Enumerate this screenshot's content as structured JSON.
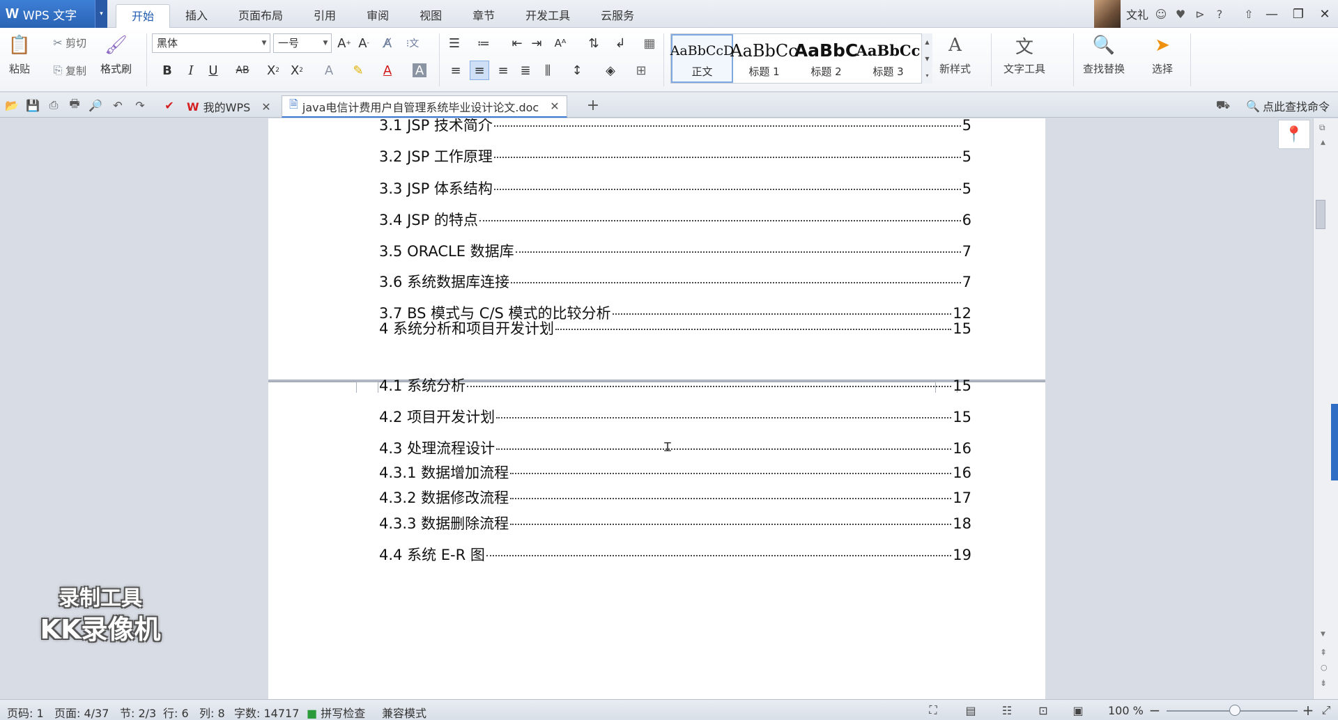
{
  "app": {
    "name": "WPS 文字",
    "logo_glyph": "W",
    "menu_arrow": "▾"
  },
  "menu_tabs": [
    "开始",
    "插入",
    "页面布局",
    "引用",
    "审阅",
    "视图",
    "章节",
    "开发工具",
    "云服务"
  ],
  "titlebar": {
    "username": "文礼",
    "help": "?",
    "minimize": "—",
    "restore": "❐",
    "close": "✕"
  },
  "ribbon": {
    "paste": "粘贴",
    "cut": "剪切",
    "copy": "复制",
    "format_painter": "格式刷",
    "font_name": "黑体",
    "font_size": "一号",
    "new_style": "新样式",
    "text_tools": "文字工具",
    "find_replace": "查找替换",
    "select": "选择",
    "styles": [
      {
        "preview": "AaBbCcD",
        "name": "正文"
      },
      {
        "preview": "AaBbCc",
        "name": "标题 1"
      },
      {
        "preview": "AaBbC",
        "name": "标题 2"
      },
      {
        "preview": "AaBbCc",
        "name": "标题 3"
      }
    ]
  },
  "doc_tabs": {
    "home": "我的WPS",
    "active_doc": "java电信计费用户自管理系统毕业设计论文.doc",
    "search_cmd": "点此查找命令"
  },
  "toc_page1": [
    {
      "text": "3.1  JSP 技术简介",
      "page": "5"
    },
    {
      "text": "3.2  JSP 工作原理",
      "page": "5"
    },
    {
      "text": "3.3  JSP 体系结构",
      "page": "5"
    },
    {
      "text": "3.4  JSP 的特点",
      "page": "6"
    },
    {
      "text": "3.5  ORACLE  数据库",
      "page": "7"
    },
    {
      "text": "3.6  系统数据库连接",
      "page": "7"
    },
    {
      "text": "3.7  BS 模式与 C/S 模式的比较分析",
      "page": "12"
    }
  ],
  "toc_page2": [
    {
      "text": "4 系统分析和项目开发计划",
      "page": "15"
    },
    {
      "text": "4.1  系统分析",
      "page": "15"
    },
    {
      "text": "4.2  项目开发计划",
      "page": "15"
    },
    {
      "text": "4.3  处理流程设计",
      "page": "16"
    },
    {
      "text": "4.3.1  数据增加流程",
      "page": "16"
    },
    {
      "text": "4.3.2  数据修改流程",
      "page": "17"
    },
    {
      "text": "4.3.3  数据删除流程",
      "page": "18"
    },
    {
      "text": "4.4  系统 E-R 图",
      "page": "19"
    }
  ],
  "status": {
    "page_num": "页码: 1",
    "page_of": "页面: 4/37",
    "section": "节: 2/3",
    "row": "行: 6",
    "col": "列: 8",
    "word_count": "字数: 14717",
    "spell_check": "拼写检查",
    "compat_mode": "兼容模式",
    "zoom": "100 %",
    "zoom_level": 0.52
  },
  "watermark": {
    "line1": "录制工具",
    "line2": "KK录像机"
  },
  "colors": {
    "accent": "#2a63b4",
    "active_tab_text": "#1e5ab0",
    "side_marker": "#2f6dc4"
  }
}
